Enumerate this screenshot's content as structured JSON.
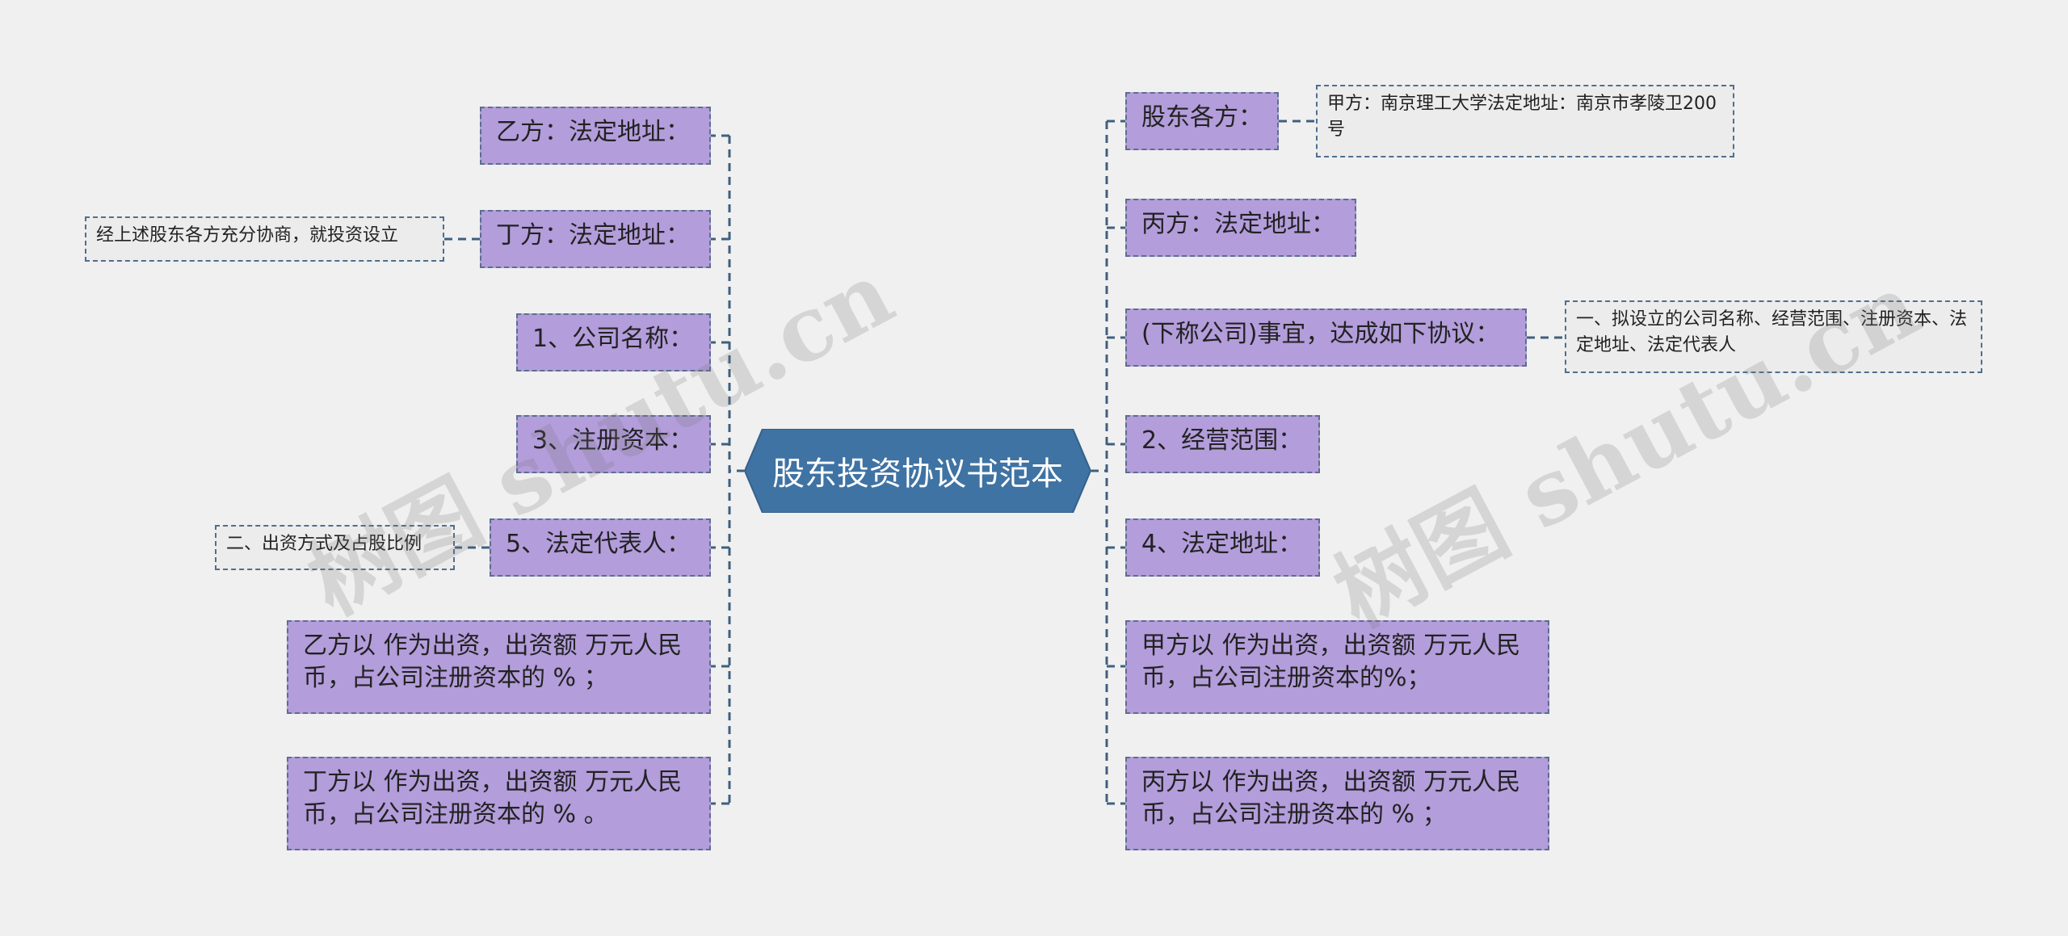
{
  "title": "股东投资协议书范本",
  "colors": {
    "background": "#f0f0f0",
    "center_fill": "#3f73a3",
    "node_fill": "#b39ddb",
    "connector": "#3f5f80"
  },
  "left_nodes": [
    {
      "label": "乙方：法定地址："
    },
    {
      "label": "丁方：法定地址：",
      "note": "经上述股东各方充分协商，就投资设立"
    },
    {
      "label": "1、公司名称："
    },
    {
      "label": "3、注册资本："
    },
    {
      "label": "5、法定代表人：",
      "note": "二、出资方式及占股比例"
    },
    {
      "label": "乙方以 作为出资，出资额 万元人民币，占公司注册资本的 % ；"
    },
    {
      "label": "丁方以 作为出资，出资额 万元人民币，占公司注册资本的 % 。"
    }
  ],
  "right_nodes": [
    {
      "label": "股东各方：",
      "note": "甲方：南京理工大学法定地址：南京市孝陵卫200号"
    },
    {
      "label": "丙方：法定地址："
    },
    {
      "label": "(下称公司)事宜，达成如下协议：",
      "note": "一、拟设立的公司名称、经营范围、注册资本、法定地址、法定代表人"
    },
    {
      "label": "2、经营范围："
    },
    {
      "label": "4、法定地址："
    },
    {
      "label": "甲方以 作为出资，出资额 万元人民币，占公司注册资本的%；"
    },
    {
      "label": "丙方以 作为出资，出资额 万元人民币，占公司注册资本的 % ；"
    }
  ],
  "watermark": "树图 shutu.cn"
}
